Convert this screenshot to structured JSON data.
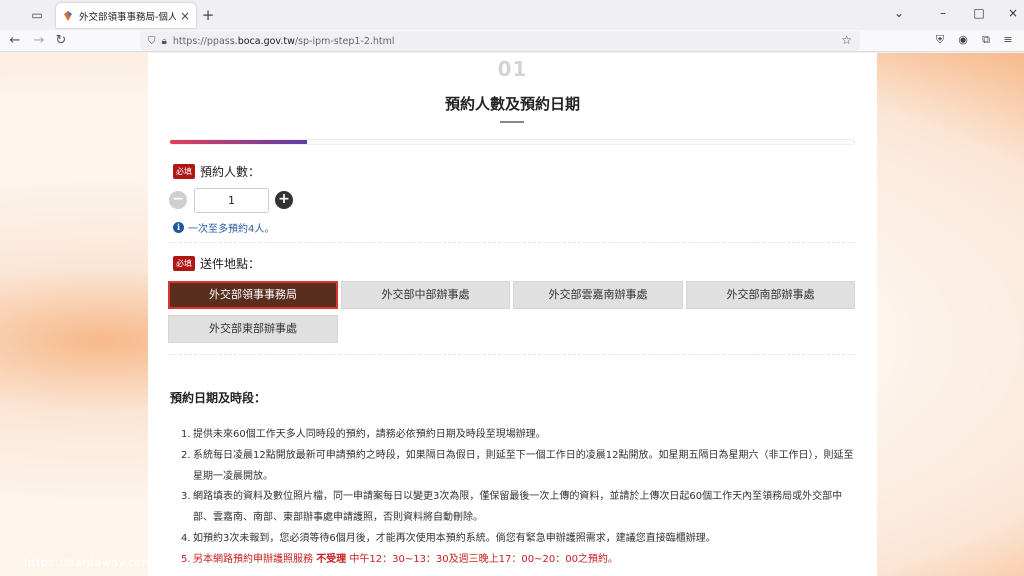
{
  "browser": {
    "tab_title": "外交部領事事務局-個人申辦護照",
    "url_prefix": "https://ppass.",
    "url_domain": "boca.gov.tw",
    "url_path": "/sp-ipm-step1-2.html"
  },
  "page": {
    "step_number": "01",
    "step_title": "預約人數及預約日期",
    "progress_percent": 20,
    "required_badge": "必填",
    "people_label": "預約人數：",
    "people_value": "1",
    "people_hint": "一次至多預約4人。",
    "location_label": "送件地點：",
    "locations": [
      {
        "label": "外交部領事事務局",
        "selected": true
      },
      {
        "label": "外交部中部辦事處",
        "selected": false
      },
      {
        "label": "外交部雲嘉南辦事處",
        "selected": false
      },
      {
        "label": "外交部南部辦事處",
        "selected": false
      },
      {
        "label": "外交部東部辦事處",
        "selected": false
      }
    ],
    "section_title": "預約日期及時段：",
    "rules": [
      {
        "num": "1.",
        "text": "提供未來60個工作天多人同時段的預約，請務必依預約日期及時段至現場辦理。"
      },
      {
        "num": "2.",
        "text": "系統每日凌晨12點開放最新可申請預約之時段，如果隔日為假日，則延至下一個工作日的凌晨12點開放。如星期五隔日為星期六（非工作日），則延至星期一凌晨開放。"
      },
      {
        "num": "3.",
        "text": "網路填表的資料及數位照片檔，同一申請案每日以變更3次為限，僅保留最後一次上傳的資料，並請於上傳次日起60個工作天內至領務局或外交部中部、雲嘉南、南部、東部辦事處申請護照，否則資料將自動刪除。"
      },
      {
        "num": "4.",
        "text": "如預約3次未報到，您必須等待6個月後，才能再次使用本預約系統。倘您有緊急申辦護照需求，建議您直接臨櫃辦理。"
      }
    ],
    "rule5": {
      "num": "5.",
      "part1": "另本網路預約申辦護照服務",
      "part2": "不受理",
      "part3": "中午12：30~13：30及週三晚上17：00~20：00之預約。"
    },
    "watermark": "https://hardaway.com"
  }
}
